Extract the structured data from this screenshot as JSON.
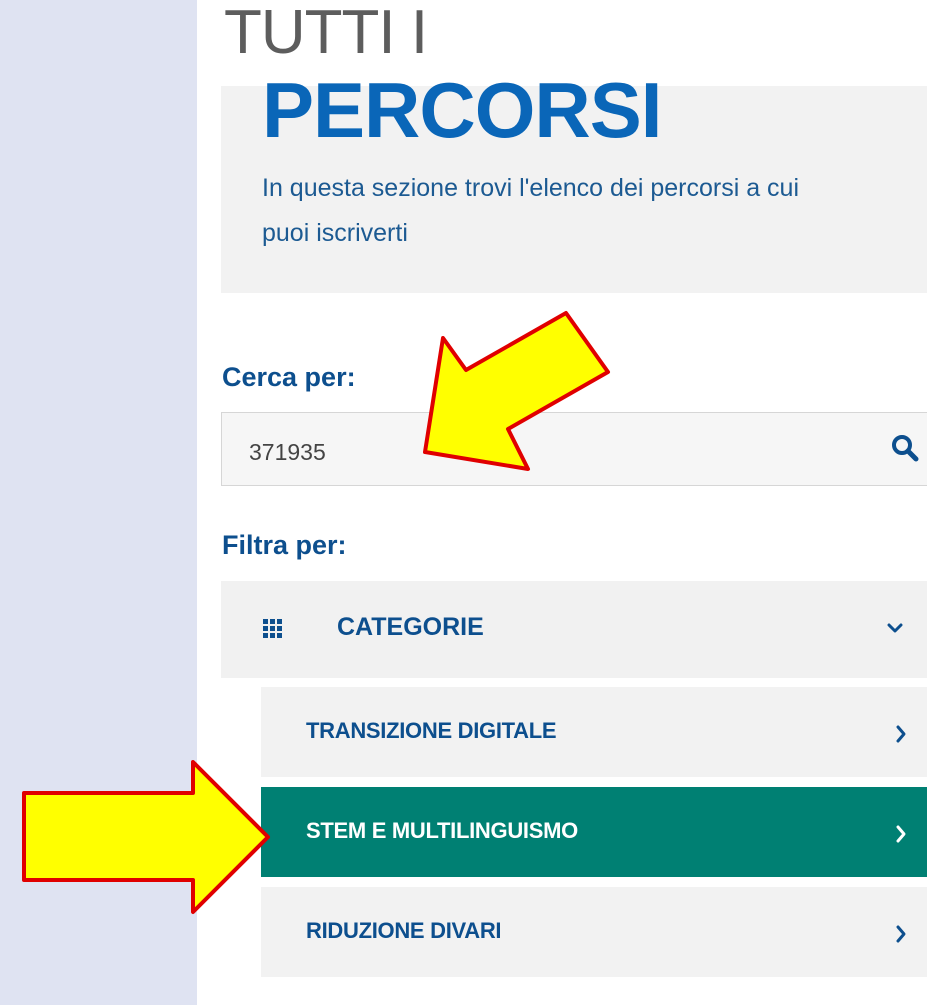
{
  "hero": {
    "title_top": "TUTTI I",
    "title_main": "PERCORSI",
    "description": "In questa sezione trovi l'elenco dei percorsi a cui puoi iscriverti"
  },
  "search": {
    "label": "Cerca per:",
    "value": "371935",
    "icon": "search-icon"
  },
  "filter": {
    "label": "Filtra per:",
    "categories_label": "CATEGORIE",
    "items": [
      {
        "label": "TRANSIZIONE DIGITALE",
        "active": false
      },
      {
        "label": "STEM E MULTILINGUISMO",
        "active": true
      },
      {
        "label": "RIDUZIONE DIVARI",
        "active": false
      }
    ]
  },
  "colors": {
    "primary_blue": "#0a66b8",
    "dark_blue": "#0d4f8e",
    "active_teal": "#008073",
    "annotation_fill": "#ffff00",
    "annotation_stroke": "#e00000"
  }
}
